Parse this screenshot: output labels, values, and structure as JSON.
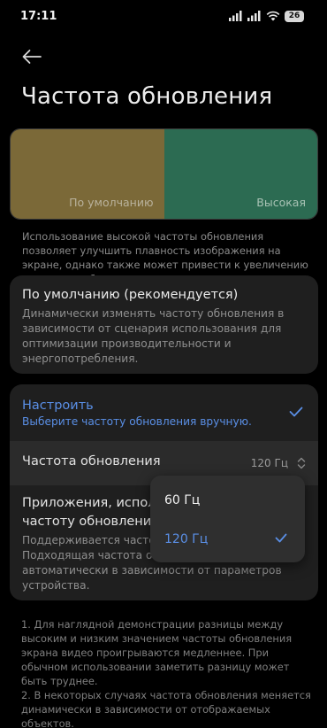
{
  "status": {
    "time": "17:11",
    "battery": "26"
  },
  "header": {
    "title": "Частота обновления"
  },
  "preview": {
    "left_label": "По умолчанию",
    "right_label": "Высокая",
    "left_color": "#7b6938",
    "right_color": "#2c6b52"
  },
  "description": "Использование высокой частоты обновления позволяет улучшить плавность изображения на экране, однако также может привести к увеличению энергопотребления.",
  "options": {
    "default": {
      "title": "По умолчанию (рекомендуется)",
      "desc": "Динамически изменять частоту обновления в зависимости от сценария использования для оптимизации производительности и энергопотребления."
    },
    "custom": {
      "title": "Настроить",
      "desc": "Выберите частоту обновления вручную.",
      "selected": true
    }
  },
  "refresh_rate": {
    "label": "Частота обновления",
    "value": "120 Гц"
  },
  "apps": {
    "title_line1": "Приложения, исполь",
    "title_line2": "частоту обновления",
    "desc_line1": "Поддерживается частота",
    "desc_line2": "Подходящая частота обн",
    "desc_line3": "автоматически в зависимости от параметров",
    "desc_line4": "устройства."
  },
  "popup": {
    "items": [
      {
        "label": "60 Гц",
        "selected": false
      },
      {
        "label": "120 Гц",
        "selected": true
      }
    ]
  },
  "footnote": "1. Для наглядной демонстрации разницы между высоким и низким значением частоты обновления экрана видео проигрываются медленнее. При обычном использовании заметить разницу может быть труднее.\n2. В некоторых случаях частота обновления меняется динамически в зависимости от отображаемых объектов.",
  "colors": {
    "accent": "#5a8fe6",
    "background": "#000000",
    "card": "#1f1f1f"
  }
}
